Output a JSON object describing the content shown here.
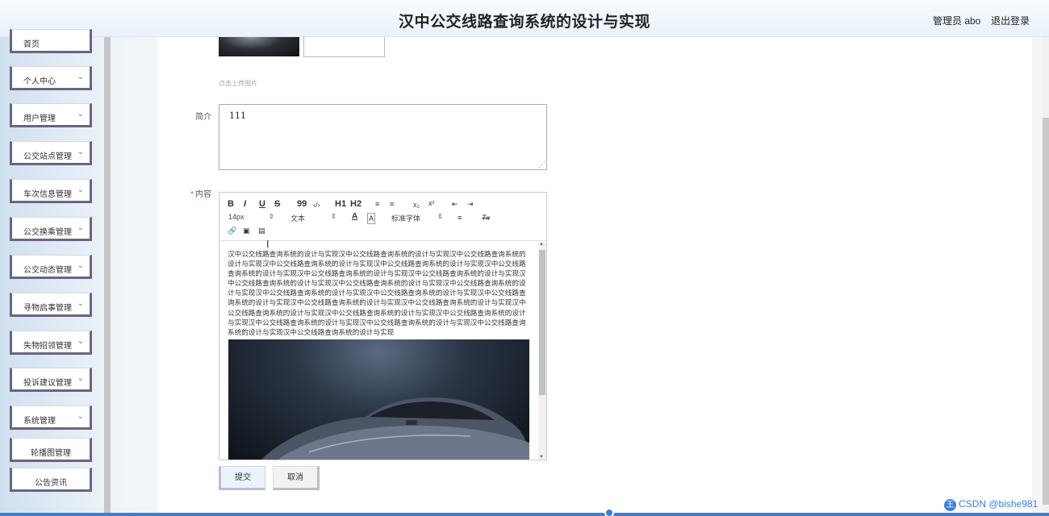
{
  "header": {
    "title": "汉中公交线路查询系统的设计与实现",
    "user": "管理员 abo",
    "logout": "退出登录"
  },
  "sidebar": {
    "items": [
      {
        "label": "首页"
      },
      {
        "label": "个人中心"
      },
      {
        "label": "用户管理"
      },
      {
        "label": "公交站点管理"
      },
      {
        "label": "车次信息管理"
      },
      {
        "label": "公交换乘管理"
      },
      {
        "label": "公交动态管理"
      },
      {
        "label": "寻物启事管理"
      },
      {
        "label": "失物招领管理"
      },
      {
        "label": "投诉建议管理"
      },
      {
        "label": "系统管理"
      },
      {
        "label": "轮播图管理"
      },
      {
        "label": "公告资讯"
      }
    ]
  },
  "form": {
    "upload_hint": "点击上传图片",
    "intro_label": "简介",
    "intro_value": "111",
    "content_label": "内容",
    "required_mark": "*",
    "editor": {
      "toolbar": {
        "bold": "B",
        "italic": "I",
        "underline": "U",
        "strike": "S",
        "quote": "99",
        "code": "‹/›",
        "h1": "H1",
        "h2": "H2",
        "ol": "≡",
        "ul": "≡",
        "sub": "x₂",
        "sup": "x²",
        "outdent": "⇤",
        "indent": "⇥",
        "size": "14px",
        "header": "文本",
        "font": "标准字体",
        "color": "A",
        "background": "A",
        "align": "≡",
        "clean": "Tx",
        "link": "🔗",
        "image": "▣",
        "video": "▤"
      },
      "content_text": "汉中公交线路查询系统的设计与实现汉中公交线路查询系统的设计与实现汉中公交线路查询系统的设计与实现汉中公交线路查询系统的设计与实现汉中公交线路查询系统的设计与实现汉中公交线路查询系统的设计与实现汉中公交线路查询系统的设计与实现汉中公交线路查询系统的设计与实现汉中公交线路查询系统的设计与实现汉中公交线路查询系统的设计与实现汉中公交线路查询系统的设计与实现汉中公交线路查询系统的设计与实现汉中公交线路查询系统的设计与实现汉中公交线路查询系统的设计与实现汉中公交线路查询系统的设计与实现汉中公交线路查询系统的设计与实现汉中公交线路查询系统的设计与实现汉中公交线路查询系统的设计与实现汉中公交线路查询系统的设计与实现汉中公交线路查询系统的设计与实现汉中公交线路查询系统的设计与实现汉中公交线路查询系统的设计与实现汉中公交线路查询系统的设计与实现"
    },
    "submit": "提交",
    "cancel": "取消"
  },
  "watermark": {
    "badge": "王",
    "text": "CSDN @bishe981"
  }
}
